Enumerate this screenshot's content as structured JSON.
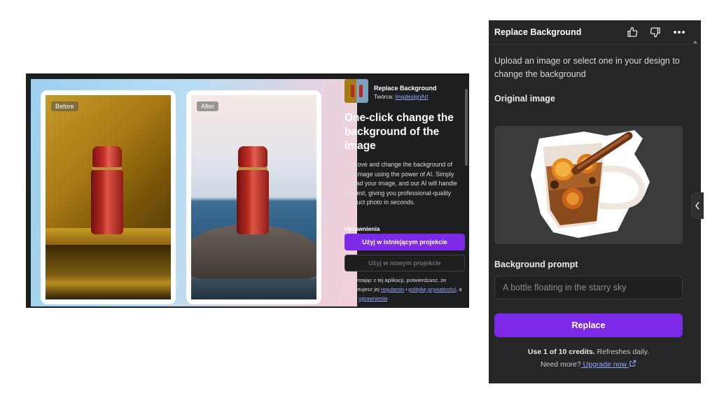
{
  "listing": {
    "before_tag": "Before",
    "after_tag": "After",
    "app_name": "Replace Background",
    "author_prefix": "Twórca: ",
    "author_name": "ImgdesignArt",
    "headline": "One-click change the background of the image",
    "description": "Remove and change the background of any image using the power of AI. Simply upload your image, and our AI will handle the rest, giving you professional-quality product photo in seconds.",
    "permissions_heading": "Uprawnienia",
    "use_existing_label": "Użyj w istniejącym projekcie",
    "use_new_label": "Użyj w nowym projekcie",
    "legal_prefix": "Korzystając z tej aplikacji, potwierdzasz, że akceptujesz jej ",
    "legal_terms": "regulamin",
    "legal_and": " i ",
    "legal_privacy": "politykę prywatności",
    "legal_also": ", a także ",
    "legal_permissions": "uprawnienia"
  },
  "panel": {
    "title": "Replace Background",
    "icons": [
      "thumbs-up-icon",
      "thumbs-down-icon",
      "more-icon"
    ],
    "intro": "Upload an image or select one in your design to change the background",
    "original_label": "Original image",
    "original_image_alt": "Glass of mulled tea with orange slices and cinnamon",
    "prompt_label": "Background prompt",
    "prompt_placeholder": "A bottle floating in the starry sky",
    "replace_label": "Replace",
    "credits_bold": "Use 1 of 10 credits.",
    "credits_rest": " Refreshes daily.",
    "need_more": "Need more?",
    "upgrade_link": " Upgrade now"
  },
  "colors": {
    "accent": "#7d2ae8",
    "panel_bg": "#252627",
    "listing_bg": "#1d1e20",
    "link": "#9aa8ff"
  }
}
